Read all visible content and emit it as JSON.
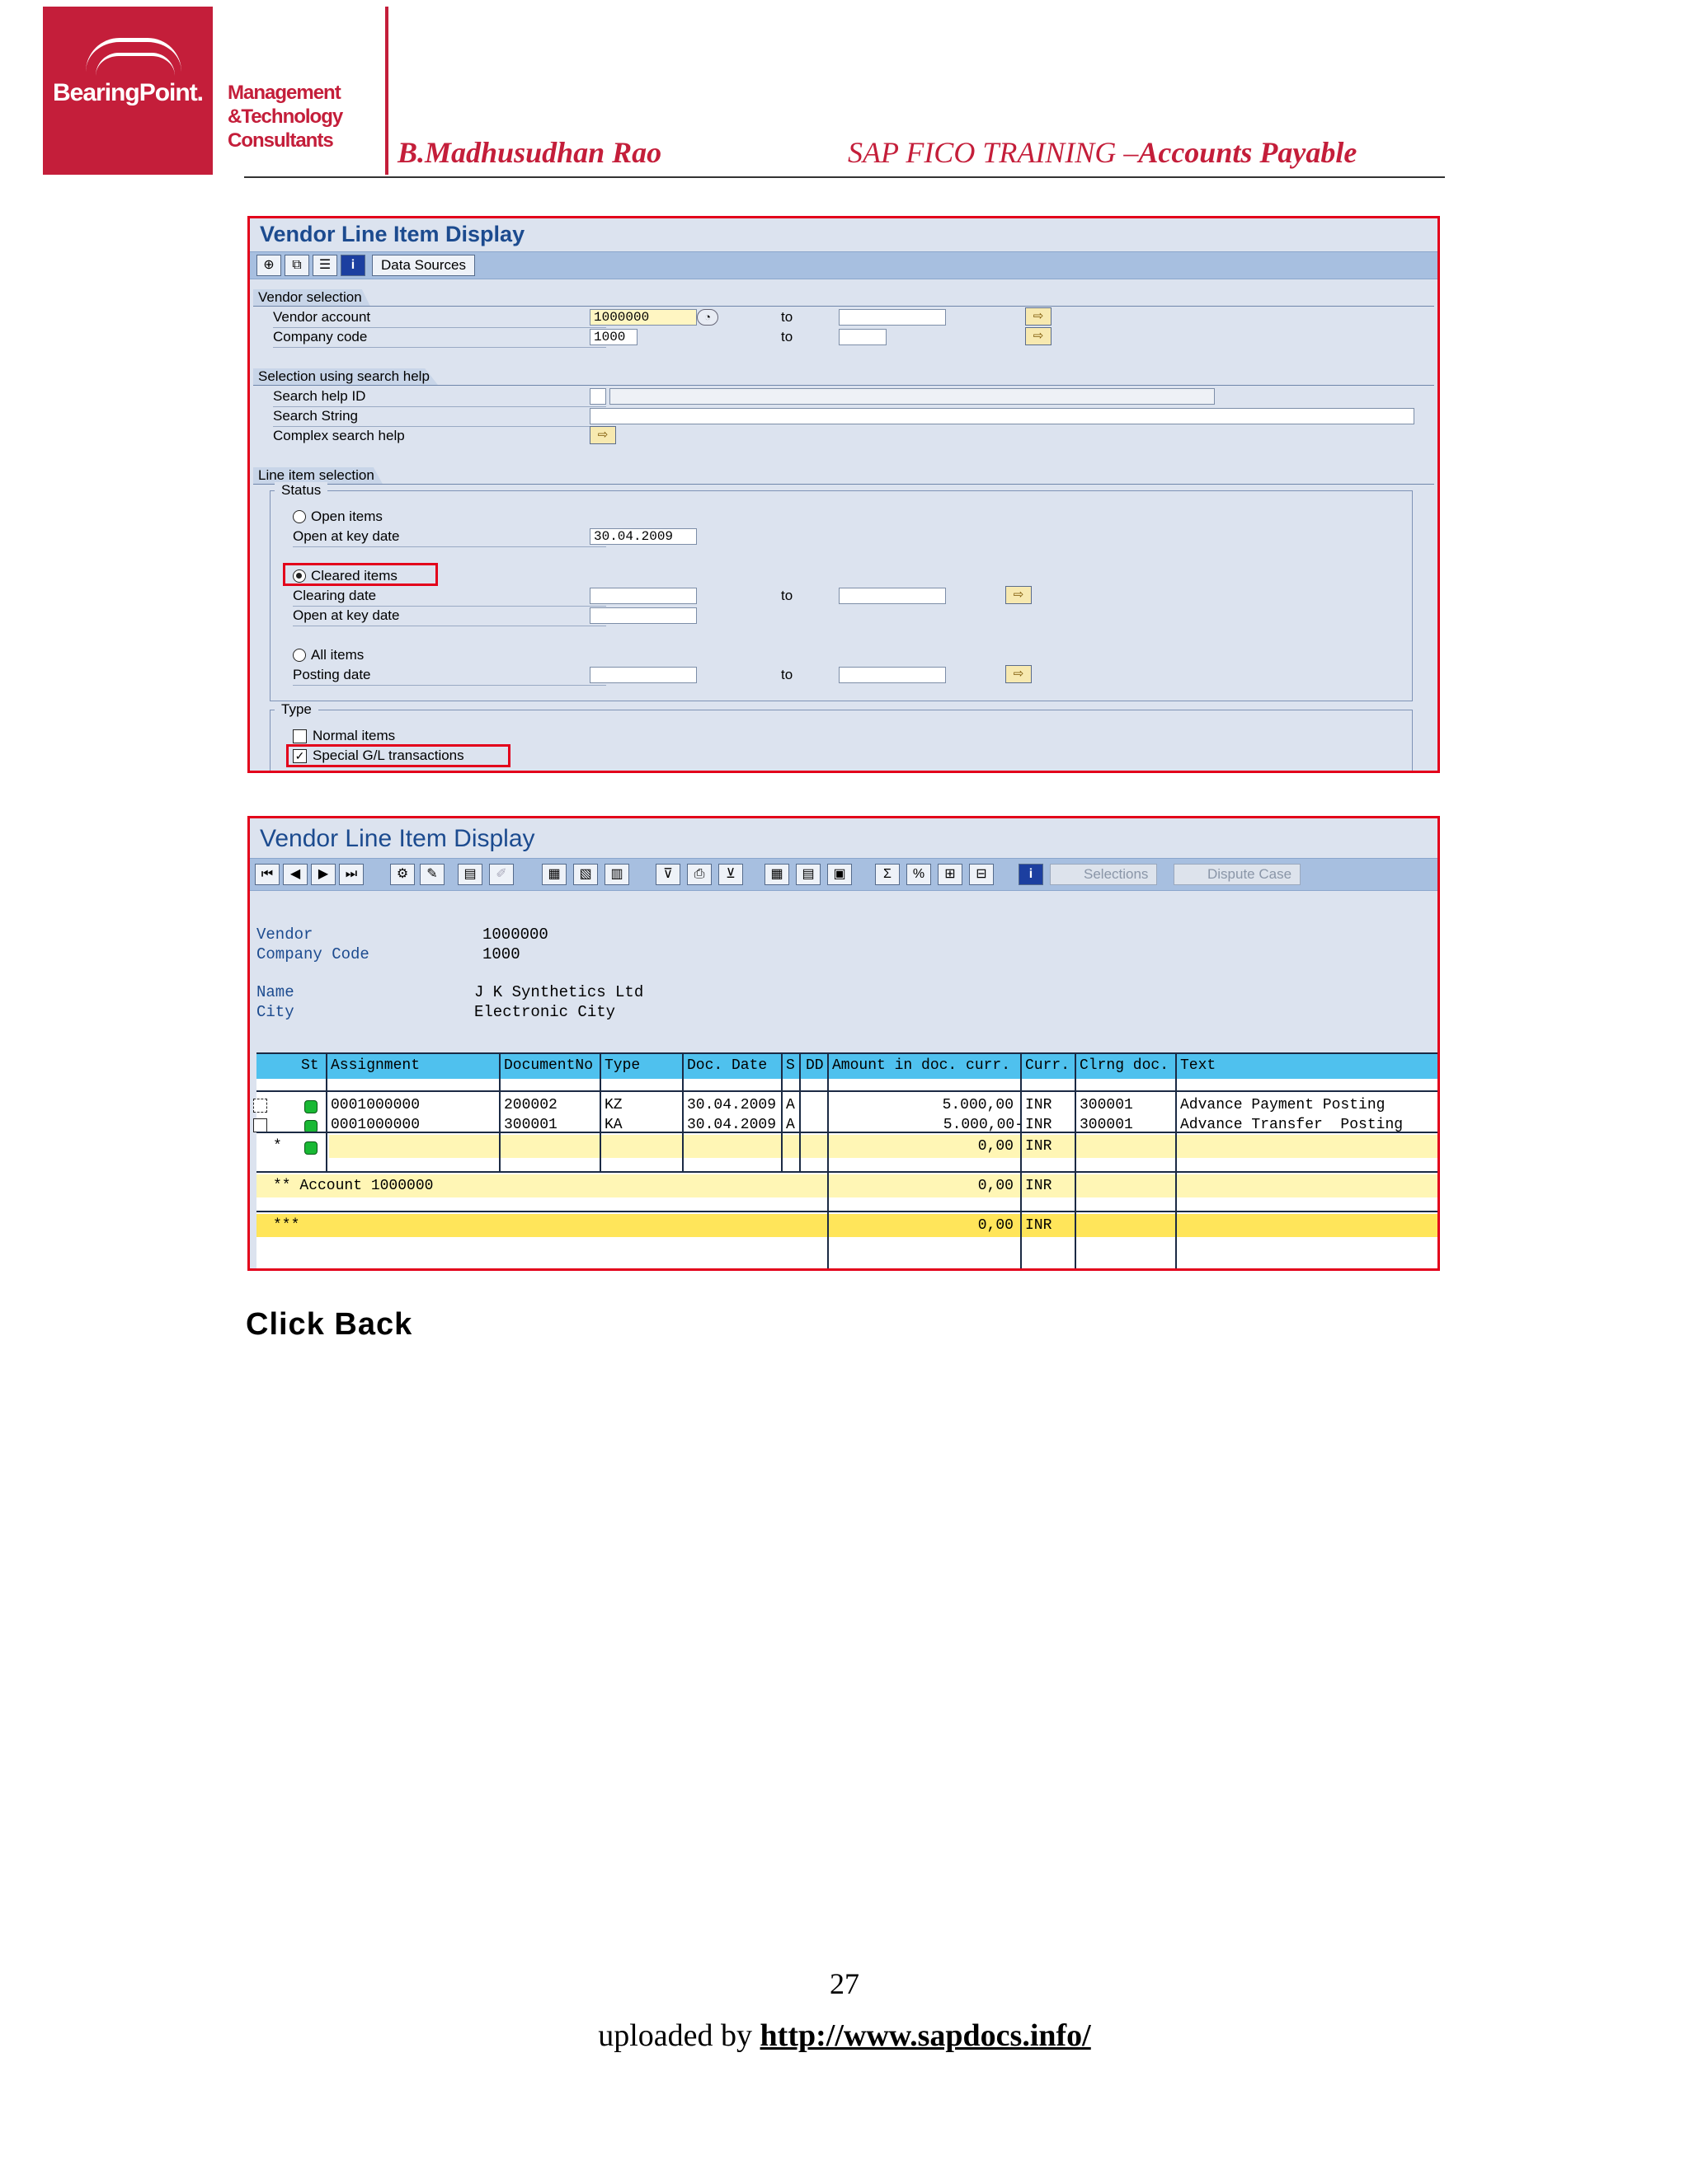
{
  "header": {
    "logo_text": "BearingPoint.",
    "tagline": [
      "Management",
      "&Technology",
      "Consultants"
    ],
    "author": "B.Madhusudhan Rao",
    "course_prefix": "SAP FICO TRAINING –",
    "course_suffix": "Accounts Payable"
  },
  "screen1": {
    "title": "Vendor Line Item Display",
    "toolbar": {
      "data_sources": "Data Sources"
    },
    "vendor_selection": {
      "heading": "Vendor selection",
      "vendor_account_label": "Vendor account",
      "vendor_account_value": "1000000",
      "company_code_label": "Company code",
      "company_code_value": "1000",
      "to": "to"
    },
    "search_help": {
      "heading": "Selection using search help",
      "search_help_id": "Search help ID",
      "search_string": "Search String",
      "complex_search_help": "Complex search help"
    },
    "line_item_selection": {
      "heading": "Line item selection",
      "status_label": "Status",
      "open_items": "Open items",
      "open_at_key_date": "Open at key date",
      "open_key_date_value": "30.04.2009",
      "cleared_items": "Cleared items",
      "clearing_date": "Clearing date",
      "open_at_key_date_2": "Open at key date",
      "all_items": "All items",
      "posting_date": "Posting date",
      "to": "to"
    },
    "type": {
      "label": "Type",
      "normal_items": "Normal items",
      "special_gl": "Special G/L transactions"
    }
  },
  "screen2": {
    "title": "Vendor Line Item Display",
    "toolbar": {
      "selections": "Selections",
      "dispute_case": "Dispute Case"
    },
    "info": {
      "vendor_label": "Vendor",
      "vendor_value": "1000000",
      "company_code_label": "Company Code",
      "company_code_value": "1000",
      "name_label": "Name",
      "name_value": "J K Synthetics Ltd",
      "city_label": "City",
      "city_value": "Electronic City"
    },
    "columns": [
      "St",
      "Assignment",
      "DocumentNo",
      "Type",
      "Doc. Date",
      "S",
      "DD",
      "Amount in doc. curr.",
      "Curr.",
      "Clrng doc.",
      "Text"
    ],
    "rows": [
      {
        "assignment": "0001000000",
        "doc_no": "200002",
        "type": "KZ",
        "doc_date": "30.04.2009",
        "s": "A",
        "amount": "5.000,00",
        "curr": "INR",
        "clrng_doc": "300001",
        "text": "Advance Payment Posting"
      },
      {
        "assignment": "0001000000",
        "doc_no": "300001",
        "type": "KA",
        "doc_date": "30.04.2009",
        "s": "A",
        "amount": "5.000,00-",
        "curr": "INR",
        "clrng_doc": "300001",
        "text": "Advance Transfer  Posting"
      }
    ],
    "subtotal": {
      "marker": "*",
      "amount": "0,00",
      "curr": "INR"
    },
    "account_total": {
      "label": "** Account 1000000",
      "amount": "0,00",
      "curr": "INR"
    },
    "grand_total": {
      "marker": "***",
      "amount": "0,00",
      "curr": "INR"
    }
  },
  "instruction": "Click Back",
  "footer": {
    "page_number": "27",
    "uploaded_by": "uploaded by ",
    "link": "http://www.sapdocs.info/"
  }
}
